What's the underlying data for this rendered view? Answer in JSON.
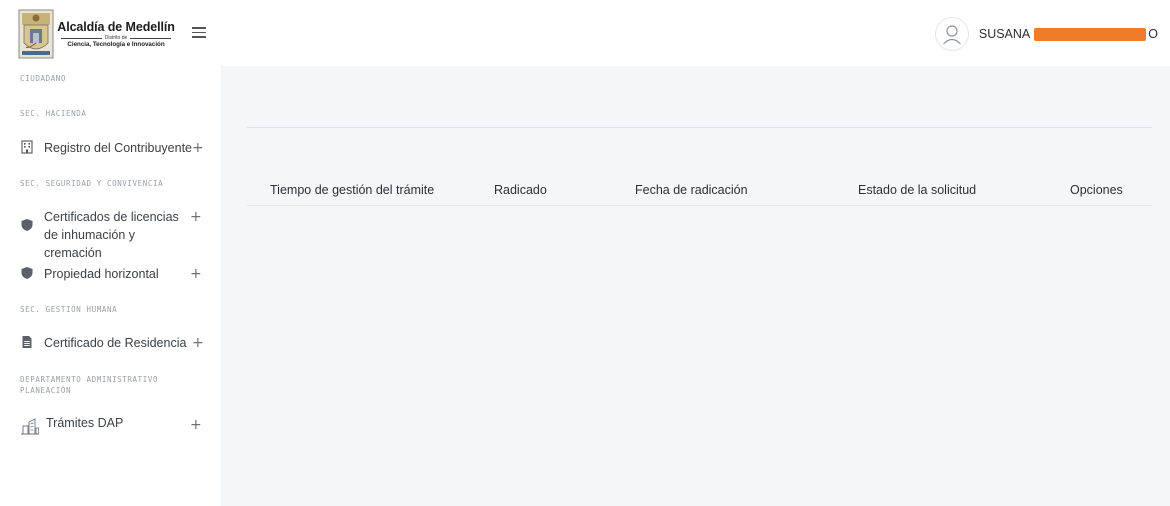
{
  "header": {
    "logo_title": "Alcaldía de Medellín",
    "logo_district": "Distrito de",
    "logo_subtitle": "Ciencia, Tecnología e Innovación",
    "user_name_visible": "SUSANA",
    "user_name_suffix": "O"
  },
  "sidebar": {
    "sections": [
      {
        "label": "CIUDADANO"
      },
      {
        "label": "SEC. HACIENDA"
      },
      {
        "label": "SEC. SEGURIDAD Y CONVIVENCIA"
      },
      {
        "label": "SEC. GESTIÓN HUMANA"
      },
      {
        "label": "DEPARTAMENTO ADMINISTRATIVO PLANEACIÓN"
      }
    ],
    "items": [
      {
        "label": "Registro del Contribuyente",
        "icon": "building-icon"
      },
      {
        "label": "Certificados de licencias de inhumación y cremación",
        "icon": "shield-icon"
      },
      {
        "label": "Propiedad horizontal",
        "icon": "shield-icon"
      },
      {
        "label": "Certificado de Residencia",
        "icon": "document-icon"
      },
      {
        "label": "Trámites DAP",
        "icon": "city-buildings-icon"
      }
    ],
    "expand_symbol": "+"
  },
  "table": {
    "columns": [
      "Tiempo de gestión del trámite",
      "Radicado",
      "Fecha de radicación",
      "Estado de la solicitud",
      "Opciones"
    ],
    "rows": []
  },
  "colors": {
    "main_background": "#f5f6f8",
    "redaction": "#f07b2a",
    "section_label": "#9aa0a7",
    "text": "#3c4146"
  }
}
